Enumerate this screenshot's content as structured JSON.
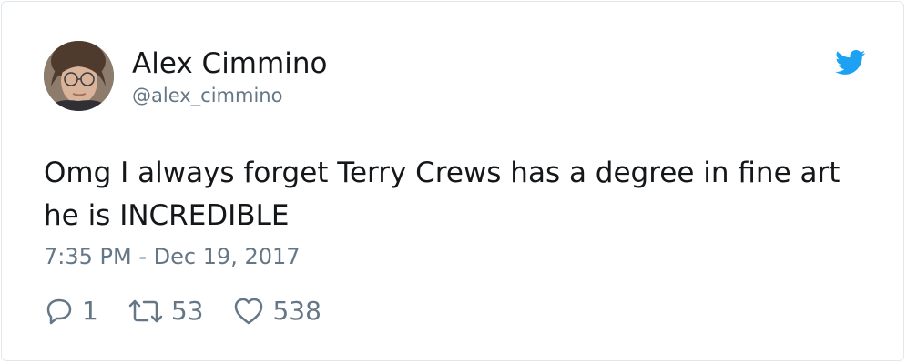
{
  "tweet": {
    "user": {
      "display_name": "Alex Cimmino",
      "handle": "@alex_cimmino"
    },
    "text": "Omg I always forget Terry Crews has a degree in fine art he is INCREDIBLE",
    "timestamp": "7:35 PM - Dec 19, 2017",
    "actions": {
      "replies": "1",
      "retweets": "53",
      "likes": "538"
    }
  },
  "colors": {
    "twitter_blue": "#1da1f2",
    "muted_text": "#657786",
    "main_text": "#14171a"
  },
  "icons": {
    "logo": "twitter-bird-icon",
    "reply": "reply-icon",
    "retweet": "retweet-icon",
    "like": "heart-icon"
  }
}
